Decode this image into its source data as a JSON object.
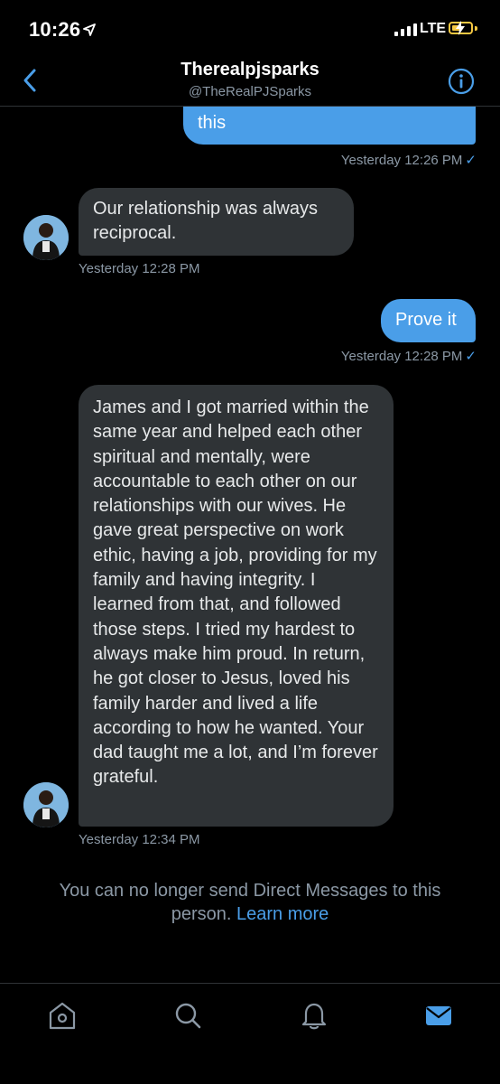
{
  "status_bar": {
    "time": "10:26",
    "network": "LTE"
  },
  "header": {
    "title": "Therealpjsparks",
    "handle": "@TheRealPJSparks"
  },
  "messages": [
    {
      "direction": "sent",
      "text": "this",
      "timestamp": "Yesterday 12:26 PM"
    },
    {
      "direction": "received",
      "text": "Our relationship was always reciprocal.",
      "timestamp": "Yesterday 12:28 PM"
    },
    {
      "direction": "sent",
      "text": "Prove it",
      "timestamp": "Yesterday 12:28 PM"
    },
    {
      "direction": "received",
      "text": "James and I got married within the same year and helped each other spiritual and mentally, were accountable to each other on our relationships with our wives. He gave great perspective on work ethic, having a job, providing for my family and having integrity. I learned from that, and followed those steps. I tried my hardest to always make him proud. In return, he got closer to Jesus, loved his family harder and lived a life according to how he wanted. Your dad taught me a lot, and I’m forever grateful.",
      "timestamp": "Yesterday 12:34 PM"
    }
  ],
  "notice": {
    "text": "You can no longer send Direct Messages to this person.",
    "link": "Learn more"
  },
  "tabs": [
    "home-icon",
    "search-icon",
    "notifications-icon",
    "messages-icon"
  ],
  "colors": {
    "accent": "#4a9ee8",
    "bubble_received": "#2f3336",
    "muted": "#8b98a5"
  }
}
